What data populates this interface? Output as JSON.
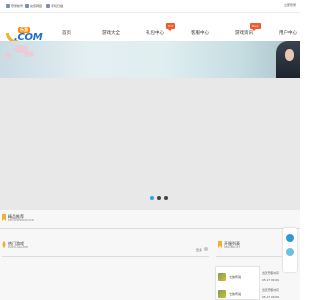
{
  "topbar": {
    "links": [
      "登录帐号",
      "充值网银",
      "手机扫描"
    ],
    "right_text": "立即登录"
  },
  "logo": {
    "badge": "乐游",
    "text": ".COM"
  },
  "nav": {
    "items": [
      "首页",
      "游戏大全",
      "礼包中心",
      "客服中心",
      "游戏资讯",
      "用户中心"
    ],
    "tags": {
      "礼包中心": "Hot",
      "游戏资讯": "New"
    }
  },
  "slider": {
    "dot_count": 3,
    "active_index": 0
  },
  "sections": {
    "recommend": {
      "title": "精品推荐",
      "en": "RECOMMENDATION"
    },
    "popular": {
      "title": "热门游戏",
      "en": "POPULARGAME"
    },
    "server": {
      "title": "开服列表",
      "en": "SERVERLIST"
    },
    "more_label": "更多"
  },
  "servers": {
    "items": [
      {
        "name": "七侠传说",
        "label_a": "当天开服时间",
        "label_b": "05-17 09:00"
      },
      {
        "name": "七侠传说",
        "label_a": "当天开服时间",
        "label_b": "05-17 09:00"
      }
    ],
    "extra_labels": [
      "开服时间",
      "当天开服"
    ]
  },
  "colors": {
    "accent": "#2aa7d9",
    "tag": "#f25a2a",
    "logo_blue": "#1b6fd1",
    "logo_orange": "#fb8c00"
  },
  "icons": [
    "user-icon",
    "bank-icon",
    "phone-icon",
    "flag-icon",
    "qq-icon"
  ]
}
